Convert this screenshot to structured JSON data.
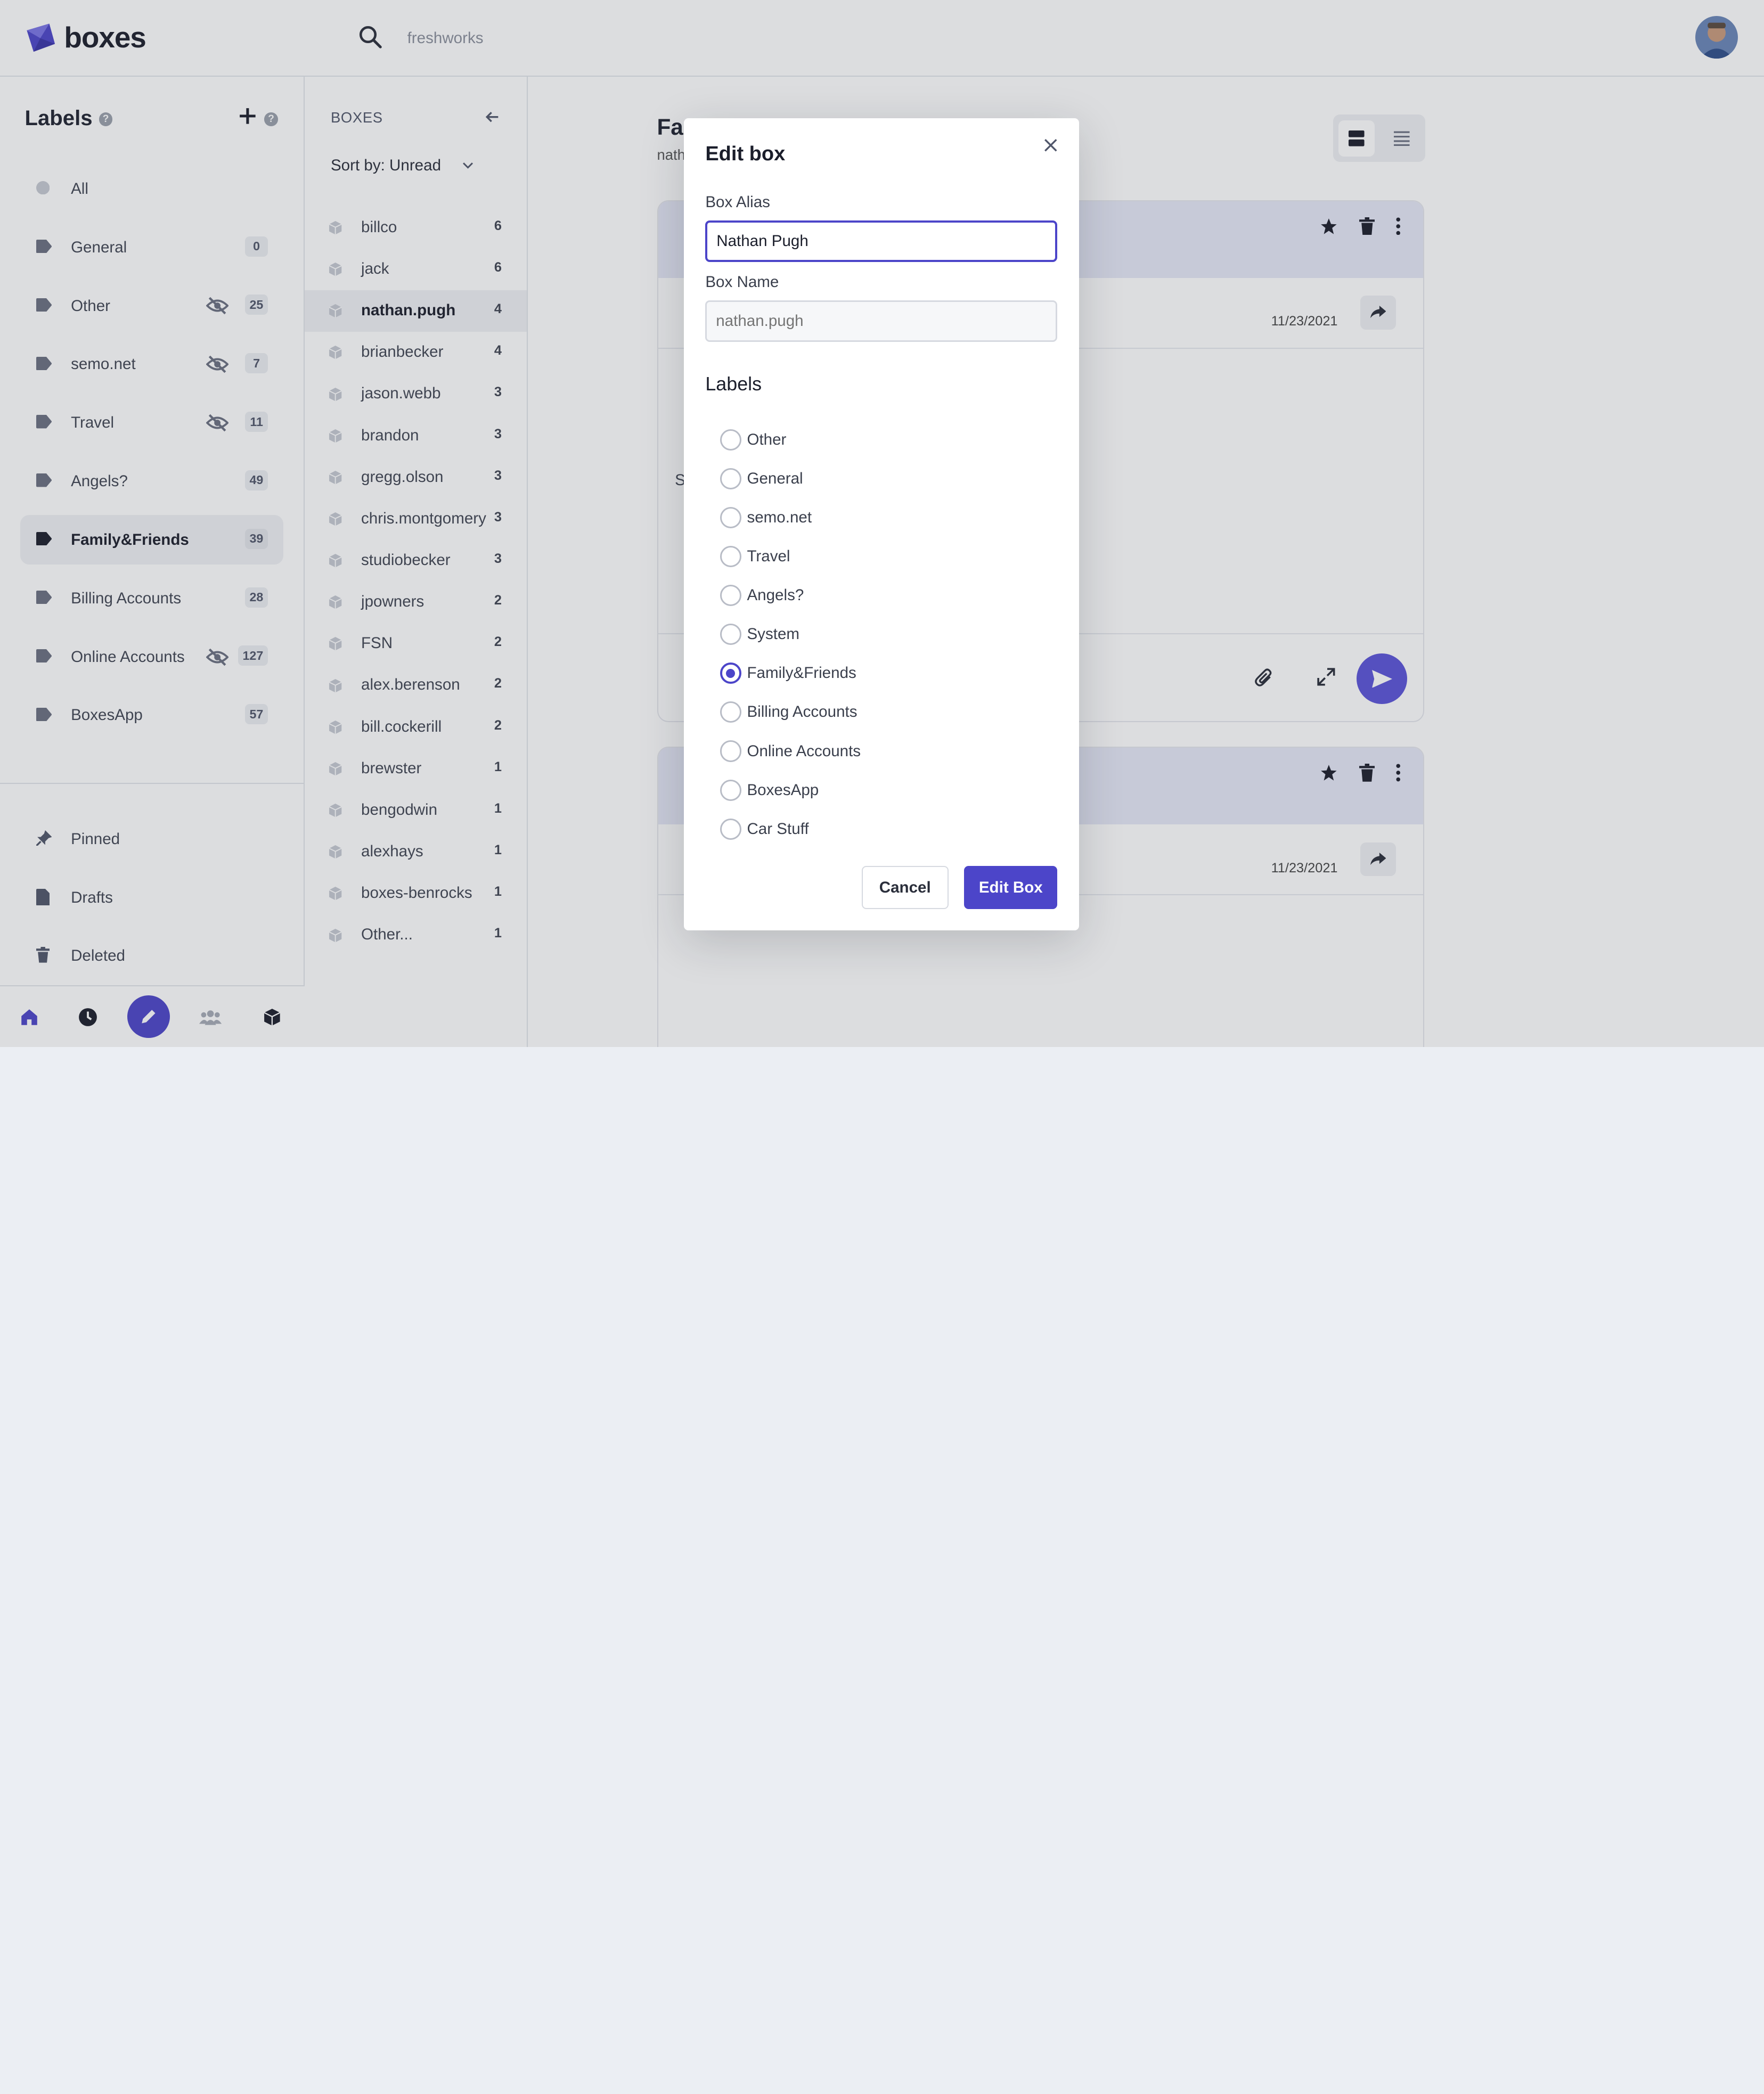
{
  "app": {
    "name": "boxes"
  },
  "search": {
    "value": "",
    "placeholder": "freshworks"
  },
  "sidebar": {
    "title": "Labels",
    "labels": [
      {
        "name": "All",
        "count": null,
        "hidden": false,
        "active": false
      },
      {
        "name": "General",
        "count": "0",
        "hidden": false,
        "active": false
      },
      {
        "name": "Other",
        "count": "25",
        "hidden": true,
        "active": false
      },
      {
        "name": "semo.net",
        "count": "7",
        "hidden": true,
        "active": false
      },
      {
        "name": "Travel",
        "count": "11",
        "hidden": true,
        "active": false
      },
      {
        "name": "Angels?",
        "count": "49",
        "hidden": false,
        "active": false
      },
      {
        "name": "Family&Friends",
        "count": "39",
        "hidden": false,
        "active": true
      },
      {
        "name": "Billing Accounts",
        "count": "28",
        "hidden": false,
        "active": false
      },
      {
        "name": "Online Accounts",
        "count": "127",
        "hidden": true,
        "active": false
      },
      {
        "name": "BoxesApp",
        "count": "57",
        "hidden": false,
        "active": false
      }
    ],
    "nav": [
      {
        "name": "Pinned",
        "icon": "pin-icon"
      },
      {
        "name": "Drafts",
        "icon": "draft-icon"
      },
      {
        "name": "Deleted",
        "icon": "trash-icon"
      }
    ]
  },
  "boxes": {
    "title": "BOXES",
    "sort_label": "Sort by: Unread",
    "items": [
      {
        "name": "billco",
        "count": "6",
        "active": false
      },
      {
        "name": "jack",
        "count": "6",
        "active": false
      },
      {
        "name": "nathan.pugh",
        "count": "4",
        "active": true
      },
      {
        "name": "brianbecker",
        "count": "4",
        "active": false
      },
      {
        "name": "jason.webb",
        "count": "3",
        "active": false
      },
      {
        "name": "brandon",
        "count": "3",
        "active": false
      },
      {
        "name": "gregg.olson",
        "count": "3",
        "active": false
      },
      {
        "name": "chris.montgomery",
        "count": "3",
        "active": false
      },
      {
        "name": "studiobecker",
        "count": "3",
        "active": false
      },
      {
        "name": "jpowners",
        "count": "2",
        "active": false
      },
      {
        "name": "FSN",
        "count": "2",
        "active": false
      },
      {
        "name": "alex.berenson",
        "count": "2",
        "active": false
      },
      {
        "name": "bill.cockerill",
        "count": "2",
        "active": false
      },
      {
        "name": "brewster",
        "count": "1",
        "active": false
      },
      {
        "name": "bengodwin",
        "count": "1",
        "active": false
      },
      {
        "name": "alexhays",
        "count": "1",
        "active": false
      },
      {
        "name": "boxes-benrocks",
        "count": "1",
        "active": false
      },
      {
        "name": "Other...",
        "count": "1",
        "active": false
      }
    ]
  },
  "main": {
    "title": "Fa",
    "subtitle": "nath",
    "cards": [
      {
        "date": "11/23/2021",
        "snippet": "S"
      },
      {
        "date": "11/23/2021"
      }
    ]
  },
  "modal": {
    "title": "Edit box",
    "alias_label": "Box Alias",
    "alias_value": "Nathan Pugh",
    "name_label": "Box Name",
    "name_placeholder": "nathan.pugh",
    "labels_heading": "Labels",
    "options": [
      {
        "label": "Other",
        "checked": false
      },
      {
        "label": "General",
        "checked": false
      },
      {
        "label": "semo.net",
        "checked": false
      },
      {
        "label": "Travel",
        "checked": false
      },
      {
        "label": "Angels?",
        "checked": false
      },
      {
        "label": "System",
        "checked": false
      },
      {
        "label": "Family&Friends",
        "checked": true
      },
      {
        "label": "Billing Accounts",
        "checked": false
      },
      {
        "label": "Online Accounts",
        "checked": false
      },
      {
        "label": "BoxesApp",
        "checked": false
      },
      {
        "label": "Car Stuff",
        "checked": false
      }
    ],
    "cancel_label": "Cancel",
    "submit_label": "Edit Box"
  },
  "colors": {
    "accent": "#4c45c9",
    "send": "#5b54d8",
    "card_header": "#e6e8f7"
  }
}
